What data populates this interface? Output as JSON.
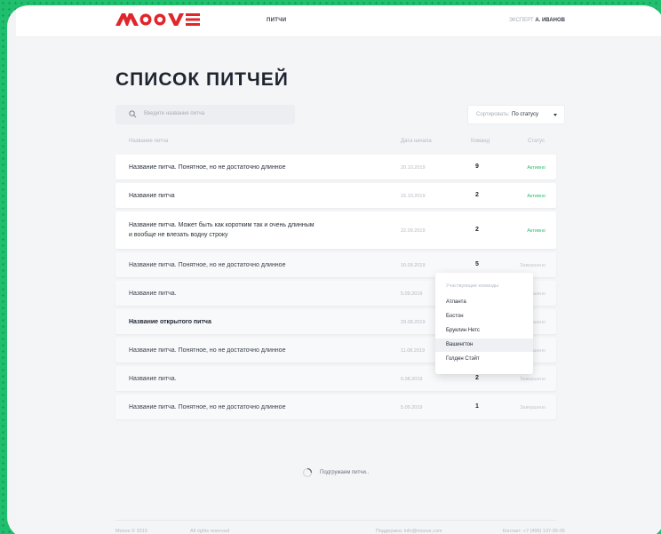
{
  "header": {
    "nav_pitches": "ПИТЧИ",
    "expert_label": "ЭКСПЕРТ",
    "expert_name": "А. ИВАНОВ"
  },
  "page_title": "СПИСОК ПИТЧЕЙ",
  "search": {
    "placeholder": "Введите название питча"
  },
  "sort": {
    "label": "Сортировать:",
    "value": "По статусу"
  },
  "columns": {
    "name": "Название питча",
    "date": "Дата начала",
    "teams": "Команд",
    "status": "Статус"
  },
  "rows": [
    {
      "name": "Название питча. Понятное, но не достаточно длинное",
      "date": "20.10.2019",
      "teams": "9",
      "status": "Активно"
    },
    {
      "name": "Название питча",
      "date": "15.10.2019",
      "teams": "2",
      "status": "Активно"
    },
    {
      "name_line1": "Название питча. Может быть как коротким так и очень длинным",
      "name_line2": "и вообще не влезать водну строку",
      "date": "22.09.2019",
      "teams": "2",
      "status": "Активно"
    },
    {
      "name": "Название питча. Понятное, но не достаточно длинное",
      "date": "10.09.2019",
      "teams": "5",
      "status": "Завершено"
    },
    {
      "name": "Название питча.",
      "date": "5.09.2019",
      "teams": "",
      "status": "Завершено"
    },
    {
      "name": "Название открытого питча",
      "date": "29.08.2019",
      "teams": "",
      "status": "Завершено"
    },
    {
      "name": "Название питча. Понятное, но не достаточно длинное",
      "date": "11.08.2019",
      "teams": "",
      "status": "Завершено"
    },
    {
      "name": "Название питча.",
      "date": "6.08.2019",
      "teams": "2",
      "status": "Завершено"
    },
    {
      "name": "Название питча. Понятное, но не достаточно длинное",
      "date": "5.09.2019",
      "teams": "1",
      "status": "Завершено"
    }
  ],
  "dropdown": {
    "header": "Участвующие команды",
    "items": [
      "Атланта",
      "Бостон",
      "Бруклин Нетс",
      "Вашингтон",
      "Голден Стэйт"
    ]
  },
  "loading_text": "Подгружаем питчи..",
  "footer": {
    "copyright": "Moove © 2019",
    "rights": "All rights reserved",
    "support": "Поддержка: info@moove.com",
    "contact": "Контакт: +7 (495) 137-95-05"
  },
  "colors": {
    "accent_red": "#e0262b",
    "active_green": "#2fbf71",
    "background_green": "#1fbf6e"
  }
}
